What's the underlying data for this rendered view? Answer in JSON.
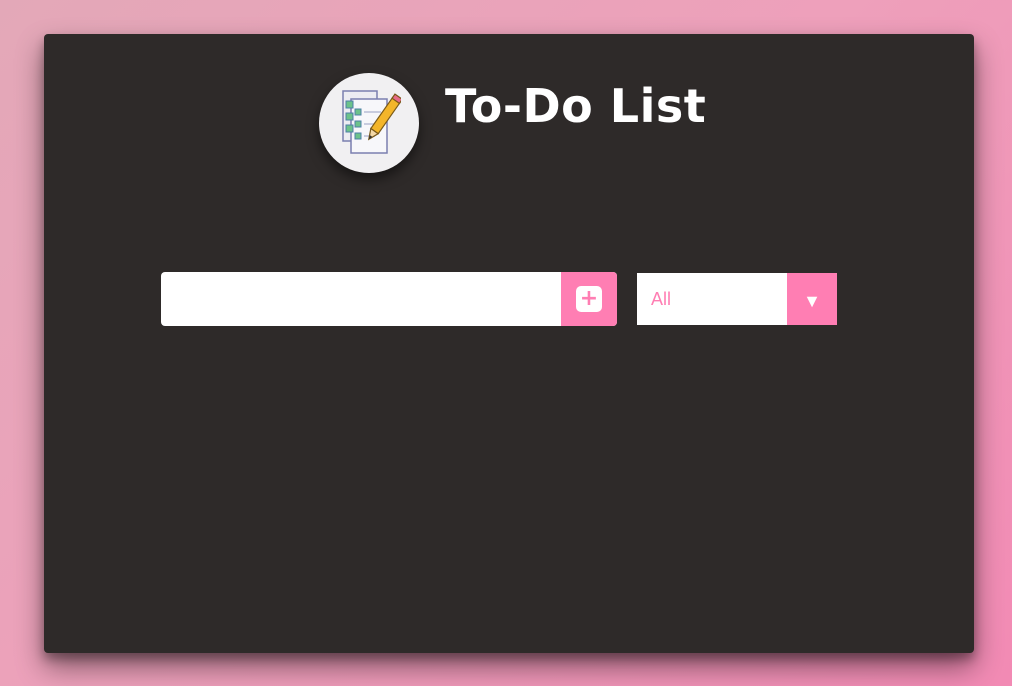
{
  "app": {
    "title": "To-Do List",
    "logo_icon": "checklist-pencil-icon"
  },
  "form": {
    "input_value": "",
    "input_placeholder": "",
    "add_button_icon": "plus-icon",
    "add_button_glyph": "+"
  },
  "filter": {
    "selected": "All",
    "arrow_icon": "triangle-down-icon",
    "arrow_glyph": "▼"
  },
  "todos": [],
  "colors": {
    "page_gradient_start": "#e3a8b8",
    "page_gradient_end": "#f28ab4",
    "card_background": "#2e2a29",
    "accent": "#ff7eb3",
    "title_text": "#ffffff"
  }
}
